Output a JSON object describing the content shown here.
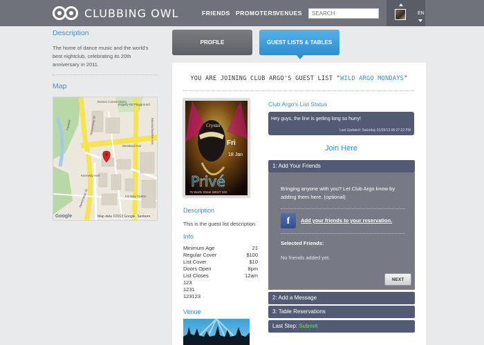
{
  "header": {
    "logo_text": "CLUBBING OWL",
    "nav": [
      "FRIENDS",
      "PROMOTERS",
      "VENUES"
    ],
    "search_placeholder": "SEARCH",
    "language": "EN"
  },
  "left": {
    "description_heading": "Description",
    "description_text": "The home of dance music and the world's best nightclub, celebrating its 20th anniversary in 2011.",
    "map_heading": "Map",
    "map_credit": "Map data ©2013 Google, Sanborn",
    "map_logo": "Google",
    "map_labels": [
      "Boston Conservatory",
      "Edgwfy Rd Playground",
      "Fenway",
      "Westland Ave",
      "Kennedy Hall",
      "Hemenway St",
      "Fenway Center",
      "Hemenway St",
      "Massachusetts Ave"
    ]
  },
  "tabs": {
    "profile": "PROFILE",
    "guest": "GUEST LISTS & TABLES"
  },
  "main": {
    "joining_prefix": "YOU ARE JOINING CLUB ARGO'S GUEST LIST \"",
    "list_name": "WILD ARGO MONDAYS",
    "joining_suffix": "\"",
    "description_heading": "Description",
    "description_text": "This is the guest list description",
    "info_heading": "Info",
    "info": [
      {
        "label": "Minimum Age",
        "value": "21"
      },
      {
        "label": "Regular Cover",
        "value": "$100"
      },
      {
        "label": "List Cover",
        "value": "$10"
      },
      {
        "label": "Doors Open",
        "value": "8pm"
      },
      {
        "label": "List Closes",
        "value": "12am"
      },
      {
        "label": "123",
        "value": ""
      },
      {
        "label": "1231",
        "value": ""
      },
      {
        "label": "123123",
        "value": ""
      }
    ],
    "venue_heading": "Venue",
    "flyer_text": {
      "brand": "Crystal",
      "title": "Privé",
      "day": "Fri",
      "date": "18 Jan",
      "address": "75 Warth Street WEST SOI"
    }
  },
  "widget": {
    "status_heading": "Club Argo's List Status",
    "status_message": "Hey guys, the line is getting long so hurry!",
    "status_updated": "Last Updated: Saturday 01/26/13 08:27:22 PM",
    "join_here": "Join Here",
    "step1_title": "1: Add Your Friends",
    "step1_text": "Bringing anyone with you? Let Club Argo know by adding them here. (optional)",
    "fb_link": "Add your friends to your reservation.",
    "selected_heading": "Selected Friends:",
    "no_friends": "No friends added yet.",
    "next_label": "NEXT",
    "step2_title": "2: Add a Message",
    "step3_title": "3: Table Reservations",
    "last_step_prefix": "Last Step: ",
    "last_step_action": "Submit"
  },
  "colors": {
    "accent": "#2f8fd0",
    "header": "#6f727a",
    "step": "#525a74",
    "submit": "#52d24a"
  }
}
